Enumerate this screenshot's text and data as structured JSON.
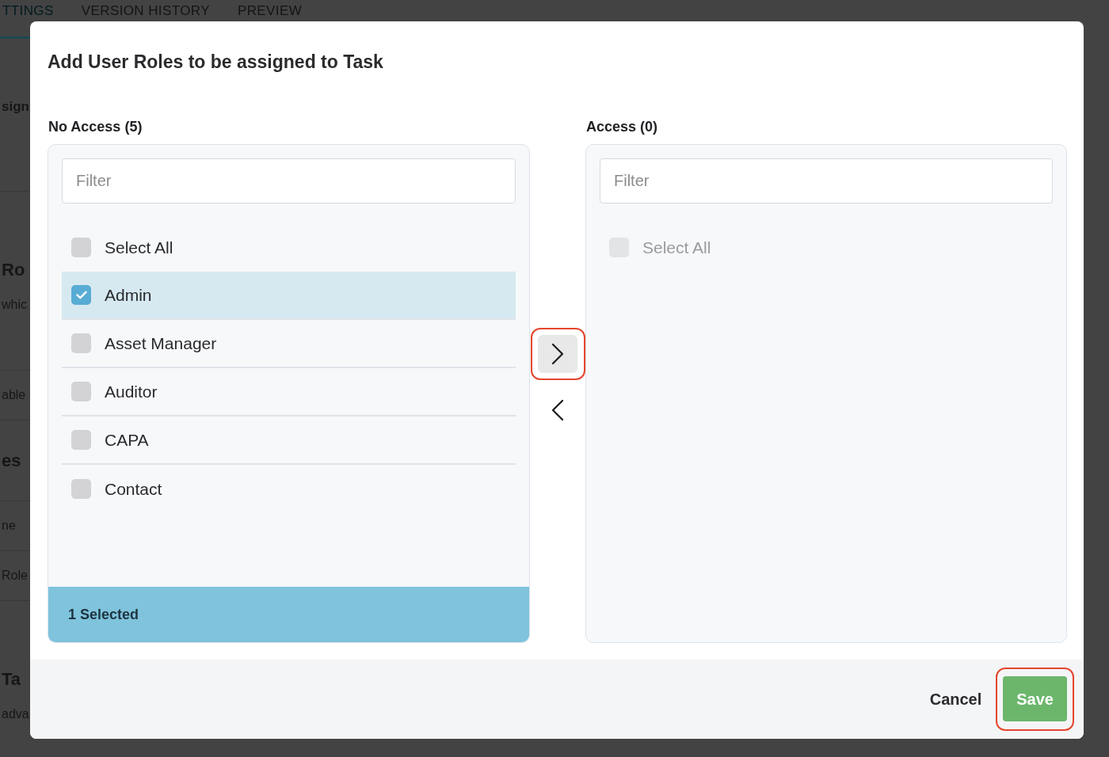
{
  "background_page": {
    "tabs": [
      {
        "label": "TTINGS",
        "selected": true
      },
      {
        "label": "VERSION HISTORY",
        "selected": false
      },
      {
        "label": "PREVIEW",
        "selected": false
      }
    ],
    "sections": [
      {
        "heading": "sign"
      },
      {
        "heading": "Ro",
        "text": "whic"
      },
      {
        "text": "able"
      },
      {
        "heading": "es"
      },
      {
        "text": "ne"
      },
      {
        "text": "Role"
      },
      {
        "heading": "Ta",
        "text": "adva"
      }
    ]
  },
  "dialog": {
    "title": "Add User Roles to be assigned to Task",
    "lists": [
      {
        "title": "No Access (5)",
        "filter": {
          "placeholder": "Filter"
        },
        "select_all": {
          "label": "Select All",
          "checked": false,
          "disabled": false
        },
        "items": [
          {
            "label": "Admin",
            "checked": true
          },
          {
            "label": "Asset Manager",
            "checked": false
          },
          {
            "label": "Auditor",
            "checked": false
          },
          {
            "label": "CAPA",
            "checked": false
          },
          {
            "label": "Contact",
            "checked": false
          }
        ],
        "selection_summary": "1 Selected"
      },
      {
        "title": "Access (0)",
        "filter": {
          "placeholder": "Filter"
        },
        "select_all": {
          "label": "Select All",
          "checked": false,
          "disabled": true
        }
      }
    ],
    "transfer_buttons": [
      {
        "kind": "move_right",
        "active": true,
        "highlighted": true
      },
      {
        "kind": "move_left",
        "active": false,
        "highlighted": false
      }
    ],
    "footer_buttons": [
      {
        "kind": "secondary",
        "label": "Cancel",
        "highlighted": false
      },
      {
        "kind": "primary",
        "label": "Save",
        "highlighted": true
      }
    ]
  }
}
